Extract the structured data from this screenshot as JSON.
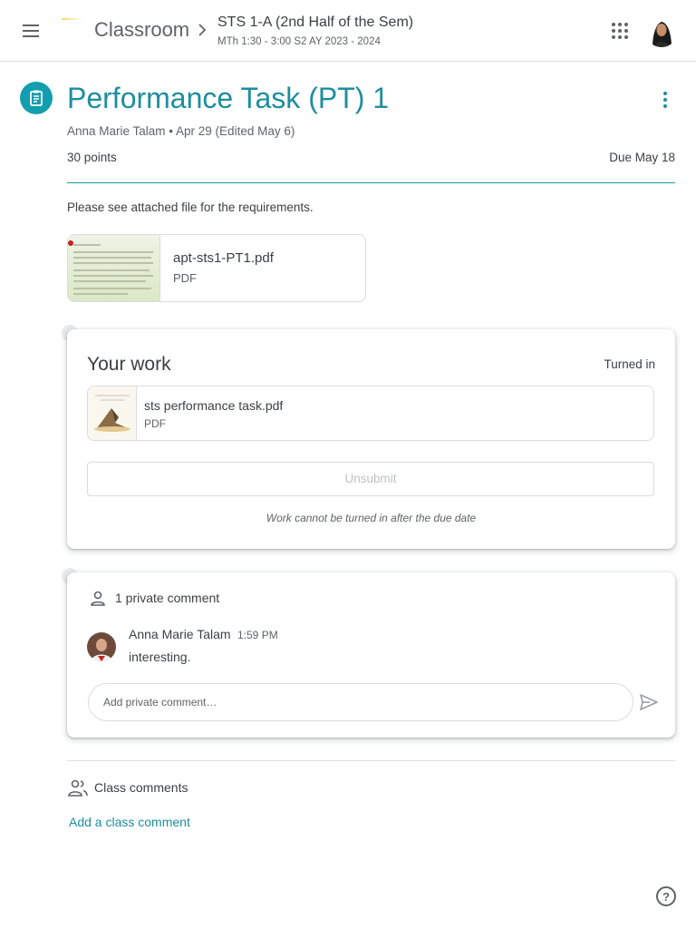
{
  "header": {
    "app_name": "Classroom",
    "class_title": "STS 1-A (2nd Half of the Sem)",
    "class_subtitle": "MTh 1:30 - 3:00 S2 AY 2023 - 2024",
    "icons": [
      "menu-icon",
      "chevron-right-icon",
      "apps-grid-icon",
      "avatar"
    ]
  },
  "assignment": {
    "title": "Performance Task (PT) 1",
    "meta": "Anna Marie Talam • Apr 29 (Edited May 6)",
    "points": "30 points",
    "due": "Due May 18",
    "instructions": "Please see attached file for the requirements.",
    "attachment": {
      "name": "apt-sts1-PT1.pdf",
      "type": "PDF"
    },
    "accent_color": "#1e8e9e"
  },
  "your_work": {
    "title": "Your work",
    "status": "Turned in",
    "file": {
      "name": "sts performance task.pdf",
      "type": "PDF"
    },
    "unsubmit_label": "Unsubmit",
    "note": "Work cannot be turned in after the due date"
  },
  "private_comments": {
    "heading": "1 private comment",
    "comments": [
      {
        "author": "Anna Marie Talam",
        "time": "1:59 PM",
        "text": "interesting."
      }
    ],
    "input_placeholder": "Add private comment…"
  },
  "class_comments": {
    "heading": "Class comments",
    "add_link": "Add a class comment"
  },
  "help": {
    "label": "?"
  }
}
